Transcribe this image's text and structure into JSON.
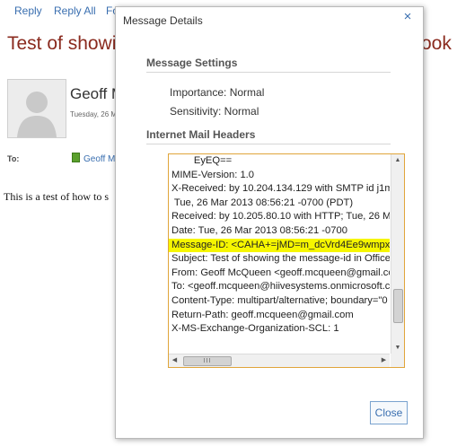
{
  "toolbar": {
    "reply": "Reply",
    "reply_all": "Reply All",
    "forward_partial": "Fo"
  },
  "message": {
    "subject_left": "Test of showi",
    "subject_right": "ook",
    "sender": "Geoff M",
    "date": "Tuesday, 26 M",
    "to_label": "To:",
    "to_recipient": "Geoff M",
    "body": "This is a test of how to s"
  },
  "dialog": {
    "title": "Message Details",
    "close_glyph": "×",
    "settings_heading": "Message Settings",
    "importance": "Importance: Normal",
    "sensitivity": "Sensitivity:   Normal",
    "headers_heading": "Internet Mail Headers",
    "header_lines": [
      "        EyEQ==",
      "MIME-Version: 1.0",
      "X-Received: by 10.204.134.129 with SMTP id j1mr",
      " Tue, 26 Mar 2013 08:56:21 -0700 (PDT)",
      "Received: by 10.205.80.10 with HTTP; Tue, 26 Mar",
      "Date: Tue, 26 Mar 2013 08:56:21 -0700",
      "Message-ID: <CAHA+=jMD=m_dcVrd4Ee9wmpx",
      "Subject: Test of showing the message-id in Office",
      "From: Geoff McQueen <geoff.mcqueen@gmail.co",
      "To: <geoff.mcqueen@hiivesystems.onmicrosoft.c",
      "Content-Type: multipart/alternative; boundary=\"0",
      "Return-Path: geoff.mcqueen@gmail.com",
      "X-MS-Exchange-Organization-SCL: 1"
    ],
    "highlighted_line": 6,
    "hscroll_grip": "III",
    "close_button": "Close"
  },
  "colors": {
    "accent": "#3a6fb0",
    "subject": "#8a2a1e",
    "highlight": "#f6f600",
    "box_border": "#e0a53a"
  }
}
